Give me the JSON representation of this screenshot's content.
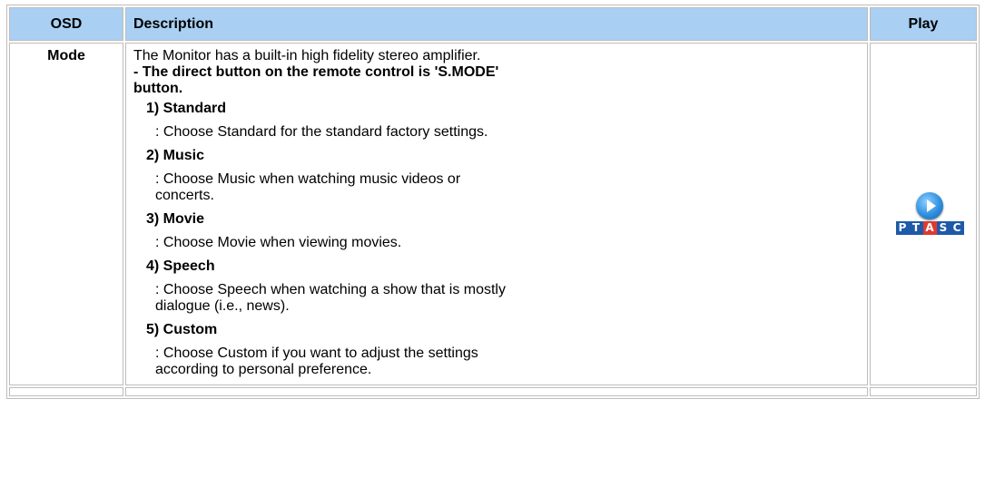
{
  "table": {
    "headers": {
      "osd": "OSD",
      "description": "Description",
      "play": "Play"
    },
    "row": {
      "osd": "Mode",
      "intro": "The Monitor has a built-in high fidelity stereo amplifier.",
      "remote_note_line1": "- The direct button on the remote control is 'S.MODE'",
      "remote_note_line2": "button.",
      "items": [
        {
          "title": "1) Standard",
          "text": ": Choose Standard for the standard factory settings.",
          "text2": ""
        },
        {
          "title": "2) Music",
          "text": ": Choose Music when watching music videos or",
          "text2": "concerts."
        },
        {
          "title": "3) Movie",
          "text": ": Choose Movie when viewing movies.",
          "text2": ""
        },
        {
          "title": "4) Speech",
          "text": ": Choose Speech when watching a show that is mostly",
          "text2": "dialogue (i.e., news)."
        },
        {
          "title": "5) Custom",
          "text": ": Choose Custom if you want to adjust the settings",
          "text2": "according to personal preference."
        }
      ],
      "play_logo": {
        "letters": [
          "P",
          "T",
          "A",
          "S",
          "C"
        ],
        "colors": [
          "#1e5aa8",
          "#1e5aa8",
          "#e03a2f",
          "#1e5aa8",
          "#1e5aa8"
        ],
        "icon": "play-icon"
      }
    }
  },
  "colors": {
    "header_bg": "#a9cff2",
    "border": "#bdbdbd"
  }
}
